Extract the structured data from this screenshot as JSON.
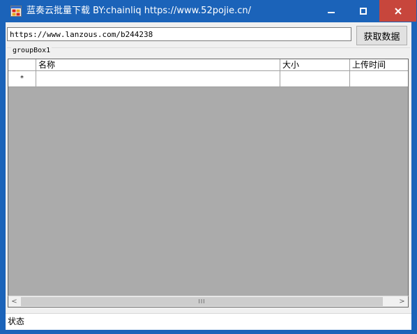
{
  "window": {
    "title": "蓝奏云批量下载 BY:chainliq https://www.52pojie.cn/",
    "icons": {
      "app": "app-icon",
      "minimize": "minimize-icon",
      "maximize": "maximize-icon",
      "close": "close-icon"
    },
    "colors": {
      "titlebar": "#1b63b9",
      "close_button": "#c7463c",
      "grid_background": "#ababab"
    }
  },
  "toolbar": {
    "url_value": "https://www.lanzous.com/b244238",
    "fetch_label": "获取数据"
  },
  "groupbox": {
    "label": "groupBox1"
  },
  "grid": {
    "columns": [
      "名称",
      "大小",
      "上传时间"
    ],
    "new_row_marker": "*",
    "rows": []
  },
  "scrollbar": {
    "left_arrow": "<",
    "right_arrow": ">",
    "thumb_grip": "III"
  },
  "status": {
    "label": "状态"
  }
}
